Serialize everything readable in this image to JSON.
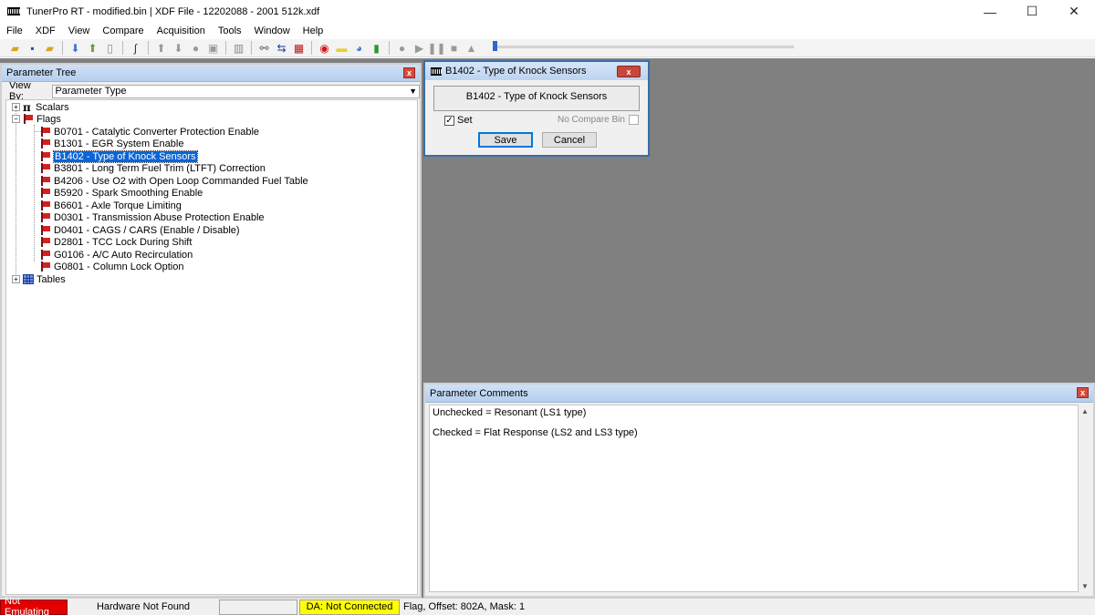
{
  "window": {
    "title": "TunerPro RT - modified.bin | XDF File - 12202088 - 2001 512k.xdf",
    "minimize": "—",
    "maximize": "☐",
    "close": "✕"
  },
  "menu": [
    "File",
    "XDF",
    "View",
    "Compare",
    "Acquisition",
    "Tools",
    "Window",
    "Help"
  ],
  "toolbar": {
    "icons": [
      "open-folder-icon",
      "save-icon",
      "save-as-icon",
      "import-icon",
      "export-icon",
      "new-document-icon",
      "wand-icon",
      "arrow-up-icon",
      "arrow-down-icon",
      "circle-icon",
      "copy-icon",
      "chip-icon",
      "link-icon",
      "swap-icon",
      "compare-icon",
      "record-icon",
      "note-icon",
      "gauge-icon",
      "chart-icon",
      "play-dot-icon",
      "play-icon",
      "pause-icon",
      "stop-icon",
      "eject-icon"
    ],
    "slider_value": 0
  },
  "parameter_tree": {
    "title": "Parameter Tree",
    "close": "x",
    "view_by_label": "View By:",
    "view_by_value": "Parameter Type",
    "scalars_label": "Scalars",
    "flags_label": "Flags",
    "tables_label": "Tables",
    "flags": [
      "B0701 - Catalytic Converter Protection Enable",
      "B1301 - EGR System Enable",
      "B1402 - Type of Knock Sensors",
      "B3801 - Long Term Fuel Trim (LTFT) Correction",
      "B4206 - Use O2 with Open Loop Commanded Fuel Table",
      "B5920 - Spark Smoothing Enable",
      "B6601 - Axle Torque Limiting",
      "D0301 - Transmission Abuse Protection Enable",
      "D0401 - CAGS / CARS (Enable / Disable)",
      "D2801 - TCC Lock During Shift",
      "G0106 - A/C Auto Recirculation",
      "G0801 - Column Lock Option"
    ],
    "selected_index": 2
  },
  "flag_dialog": {
    "title": "B1402 - Type of Knock Sensors",
    "label": "B1402 - Type of Knock Sensors",
    "set_label": "Set",
    "set_checked": "✓",
    "no_compare_label": "No Compare Bin",
    "save_label": "Save",
    "cancel_label": "Cancel",
    "close": "x"
  },
  "comments": {
    "title": "Parameter Comments",
    "close": "x",
    "lines": [
      "Unchecked = Resonant (LS1 type)",
      "Checked = Flat Response (LS2 and LS3 type)"
    ]
  },
  "status": {
    "emulation": "Not Emulating",
    "hardware": "Hardware Not Found",
    "empty": "",
    "da": "DA: Not Connected",
    "info": "Flag, Offset: 802A,  Mask: 1"
  }
}
